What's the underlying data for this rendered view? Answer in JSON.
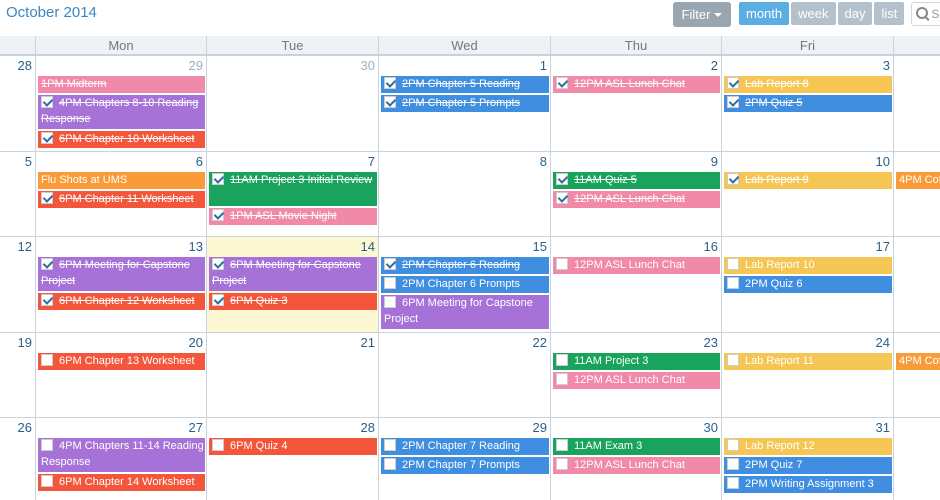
{
  "header": {
    "title": "October 2014",
    "filter_label": "Filter",
    "search_placeholder": "S"
  },
  "views": [
    {
      "label": "month",
      "active": true
    },
    {
      "label": "week",
      "active": false
    },
    {
      "label": "day",
      "active": false
    },
    {
      "label": "list",
      "active": false
    }
  ],
  "colors": {
    "pink": "#f08aa8",
    "purple": "#a672d8",
    "red": "#f4563b",
    "blue": "#3f8ee0",
    "green": "#1aa35c",
    "yellow": "#f5c653",
    "orange": "#f89b38",
    "today": "#fcf8d3"
  },
  "days_of_week": [
    "Mon",
    "Tue",
    "Wed",
    "Thu",
    "Fri"
  ],
  "weeks": [
    {
      "days": [
        {
          "num": "28",
          "other": false,
          "events": []
        },
        {
          "num": "29",
          "other": true,
          "events": [
            {
              "text": "1PM Midterm",
              "color": "pink",
              "done": true,
              "cb": false
            },
            {
              "text": "4PM Chapters 8-10 Reading Response",
              "color": "purple",
              "done": true,
              "cb": true,
              "two": true
            },
            {
              "text": "6PM Chapter 10 Worksheet",
              "color": "red",
              "done": true,
              "cb": true
            }
          ]
        },
        {
          "num": "30",
          "other": true,
          "events": []
        },
        {
          "num": "1",
          "other": false,
          "events": [
            {
              "text": "2PM Chapter 5 Reading",
              "color": "blue",
              "done": true,
              "cb": true
            },
            {
              "text": "2PM Chapter 5 Prompts",
              "color": "blue",
              "done": true,
              "cb": true
            }
          ]
        },
        {
          "num": "2",
          "other": false,
          "events": [
            {
              "text": "12PM ASL Lunch Chat",
              "color": "pink",
              "done": true,
              "cb": true
            }
          ]
        },
        {
          "num": "3",
          "other": false,
          "events": [
            {
              "text": "Lab Report 8",
              "color": "yellow",
              "done": true,
              "cb": true
            },
            {
              "text": "2PM Quiz 5",
              "color": "blue",
              "done": true,
              "cb": true
            }
          ]
        }
      ]
    },
    {
      "days": [
        {
          "num": "5",
          "other": false,
          "events": []
        },
        {
          "num": "6",
          "other": false,
          "events": [
            {
              "text": "Flu Shots at UMS",
              "color": "orange",
              "done": false,
              "cb": false
            },
            {
              "text": "6PM Chapter 11 Worksheet",
              "color": "red",
              "done": true,
              "cb": true
            }
          ]
        },
        {
          "num": "7",
          "other": false,
          "events": [
            {
              "text": "11AM Project 3 Initial Review",
              "color": "green",
              "done": true,
              "cb": true,
              "two": true
            },
            {
              "text": "1PM ASL Movie Night",
              "color": "pink",
              "done": true,
              "cb": true
            }
          ]
        },
        {
          "num": "8",
          "other": false,
          "events": []
        },
        {
          "num": "9",
          "other": false,
          "events": [
            {
              "text": "11AM Quiz 5",
              "color": "green",
              "done": true,
              "cb": true
            },
            {
              "text": "12PM ASL Lunch Chat",
              "color": "pink",
              "done": true,
              "cb": true
            }
          ]
        },
        {
          "num": "10",
          "other": false,
          "events": [
            {
              "text": "Lab Report 9",
              "color": "yellow",
              "done": true,
              "cb": true
            }
          ]
        }
      ],
      "overflow": {
        "text": "4PM Cof",
        "color": "orange"
      }
    },
    {
      "days": [
        {
          "num": "12",
          "other": false,
          "events": []
        },
        {
          "num": "13",
          "other": false,
          "events": [
            {
              "text": "6PM Meeting for Capstone Project",
              "color": "purple",
              "done": true,
              "cb": true,
              "two": true
            },
            {
              "text": "6PM Chapter 12 Worksheet",
              "color": "red",
              "done": true,
              "cb": true
            }
          ]
        },
        {
          "num": "14",
          "other": false,
          "today": true,
          "events": [
            {
              "text": "6PM Meeting for Capstone Project",
              "color": "purple",
              "done": true,
              "cb": true,
              "two": true
            },
            {
              "text": "6PM Quiz 3",
              "color": "red",
              "done": true,
              "cb": true
            }
          ]
        },
        {
          "num": "15",
          "other": false,
          "events": [
            {
              "text": "2PM Chapter 6 Reading",
              "color": "blue",
              "done": true,
              "cb": true
            },
            {
              "text": "2PM Chapter 6 Prompts",
              "color": "blue",
              "done": false,
              "cb": true
            },
            {
              "text": "6PM Meeting for Capstone Project",
              "color": "purple",
              "done": false,
              "cb": true,
              "two": true
            }
          ]
        },
        {
          "num": "16",
          "other": false,
          "events": [
            {
              "text": "12PM ASL Lunch Chat",
              "color": "pink",
              "done": false,
              "cb": true
            }
          ]
        },
        {
          "num": "17",
          "other": false,
          "events": [
            {
              "text": "Lab Report 10",
              "color": "yellow",
              "done": false,
              "cb": true
            },
            {
              "text": "2PM Quiz 6",
              "color": "blue",
              "done": false,
              "cb": true
            }
          ]
        }
      ]
    },
    {
      "days": [
        {
          "num": "19",
          "other": false,
          "events": []
        },
        {
          "num": "20",
          "other": false,
          "events": [
            {
              "text": "6PM Chapter 13 Worksheet",
              "color": "red",
              "done": false,
              "cb": true
            }
          ]
        },
        {
          "num": "21",
          "other": false,
          "events": []
        },
        {
          "num": "22",
          "other": false,
          "events": []
        },
        {
          "num": "23",
          "other": false,
          "events": [
            {
              "text": "11AM Project 3",
              "color": "green",
              "done": false,
              "cb": true
            },
            {
              "text": "12PM ASL Lunch Chat",
              "color": "pink",
              "done": false,
              "cb": true
            }
          ]
        },
        {
          "num": "24",
          "other": false,
          "events": [
            {
              "text": "Lab Report 11",
              "color": "yellow",
              "done": false,
              "cb": true
            }
          ]
        }
      ],
      "overflow": {
        "text": "4PM Cof",
        "color": "orange"
      }
    },
    {
      "days": [
        {
          "num": "26",
          "other": false,
          "events": []
        },
        {
          "num": "27",
          "other": false,
          "events": [
            {
              "text": "4PM Chapters 11-14 Reading Response",
              "color": "purple",
              "done": false,
              "cb": true,
              "two": true
            },
            {
              "text": "6PM Chapter 14 Worksheet",
              "color": "red",
              "done": false,
              "cb": true
            }
          ]
        },
        {
          "num": "28",
          "other": false,
          "events": [
            {
              "text": "6PM Quiz 4",
              "color": "red",
              "done": false,
              "cb": true
            }
          ]
        },
        {
          "num": "29",
          "other": false,
          "events": [
            {
              "text": "2PM Chapter 7 Reading",
              "color": "blue",
              "done": false,
              "cb": true
            },
            {
              "text": "2PM Chapter 7 Prompts",
              "color": "blue",
              "done": false,
              "cb": true
            }
          ]
        },
        {
          "num": "30",
          "other": false,
          "events": [
            {
              "text": "11AM Exam 3",
              "color": "green",
              "done": false,
              "cb": true
            },
            {
              "text": "12PM ASL Lunch Chat",
              "color": "pink",
              "done": false,
              "cb": true
            }
          ]
        },
        {
          "num": "31",
          "other": false,
          "events": [
            {
              "text": "Lab Report 12",
              "color": "yellow",
              "done": false,
              "cb": true
            },
            {
              "text": "2PM Quiz 7",
              "color": "blue",
              "done": false,
              "cb": true
            },
            {
              "text": "2PM Writing Assignment 3",
              "color": "blue",
              "done": false,
              "cb": true
            }
          ]
        }
      ]
    }
  ]
}
